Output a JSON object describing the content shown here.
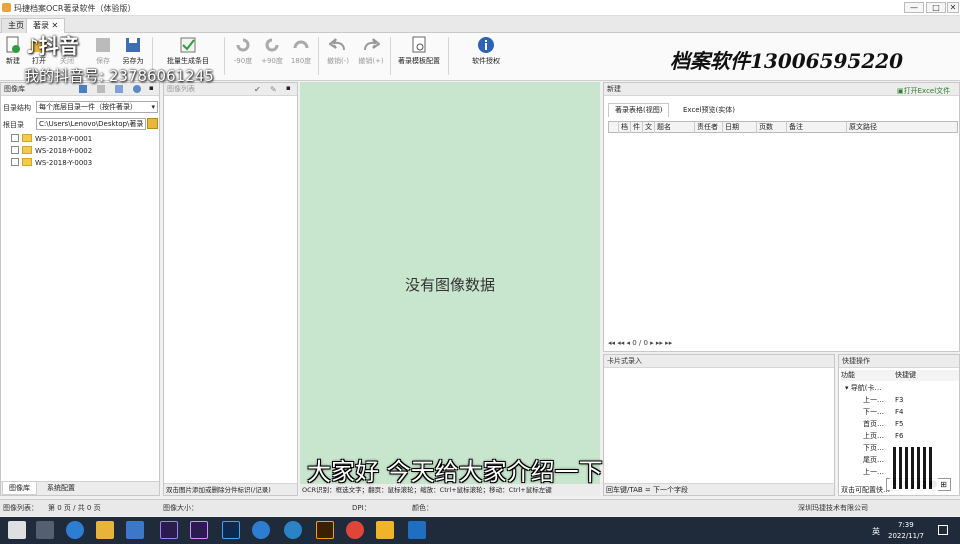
{
  "window": {
    "title": "玛捷档案OCR著录软件（体验版）",
    "minimize": "—",
    "maximize": "□",
    "close": "✕"
  },
  "tabs": [
    {
      "label": "主页"
    },
    {
      "label": "著录"
    }
  ],
  "ribbon": {
    "new": "新建",
    "open": "打开",
    "close": "关闭",
    "save": "保存",
    "save_as": "另存为",
    "batch": "批量生成条目",
    "rot_minus90": "-90度",
    "rot_plus90": "+90度",
    "rot_180": "180度",
    "undo": "撤销(-)",
    "redo": "撤销(+)",
    "template": "著录模板配置",
    "license": "软件授权"
  },
  "watermark": {
    "logo": "抖音",
    "id": "我的抖音号: 2378606124​5"
  },
  "promo": "档案软件13006595220",
  "left": {
    "header": "图像库",
    "struct_label": "目录结构",
    "struct_value": "每个底层目录一件（按件著录）",
    "root_label": "根目录",
    "root_value": "C:\\Users\\Lenovo\\Desktop\\著录",
    "items": [
      {
        "name": "WS-2018-Y-0001"
      },
      {
        "name": "WS-2018-Y-0002"
      },
      {
        "name": "WS-2018-Y-0003"
      }
    ],
    "bottom_tabs": [
      "图像库",
      "系统配置"
    ]
  },
  "list": {
    "header": "图像列表",
    "hint": "双击图片添加或删除分件标识(/记录)"
  },
  "viewer": {
    "empty": "没有图像数据",
    "hint": "OCR识别：框选文字；翻页：鼠标滚轮；缩放：Ctrl+鼠标滚轮；移动：Ctrl+鼠标左键"
  },
  "right": {
    "header": "新建",
    "open_excel": "打开Excel文件",
    "subtabs": [
      "著录表格(视图)",
      "Excel预览(实体)"
    ],
    "columns": [
      "档",
      "件",
      "文",
      "题名",
      "责任者",
      "日期",
      "页数",
      "备注",
      "原文路径"
    ],
    "pager": "◂◂ ◂◂ ◂ 0 / 0 ▸ ▸▸ ▸▸"
  },
  "card": {
    "header": "卡片式录入",
    "hint": "回车键/TAB = 下一个字段"
  },
  "hotkeys": {
    "header": "快捷操作",
    "col_func": "功能",
    "col_key": "快捷键",
    "group": "导航(卡…",
    "rows": [
      {
        "func": "上一…",
        "key": "F3"
      },
      {
        "func": "下一…",
        "key": "F4"
      },
      {
        "func": "首页…",
        "key": "F5"
      },
      {
        "func": "上页…",
        "key": "F6"
      },
      {
        "func": "下页…",
        "key": ""
      },
      {
        "func": "尾页…",
        "key": ""
      },
      {
        "func": "上一…",
        "key": ""
      }
    ],
    "hint": "双击可配置快…"
  },
  "status": {
    "list_label": "图像列表：",
    "list_value": "第 0 页 / 共 0 页",
    "size_label": "图像大小：",
    "dpi_label": "DPI：",
    "color_label": "颜色：",
    "company": "深圳玛捷技术有限公司"
  },
  "taskbar": {
    "time": "7:39",
    "date": "2022/11/7",
    "ime": "英"
  },
  "subtitle": "大家好 今天给大家介绍一下",
  "ime_bar": "囲 英 ♪ 简 ☻ ⊞"
}
